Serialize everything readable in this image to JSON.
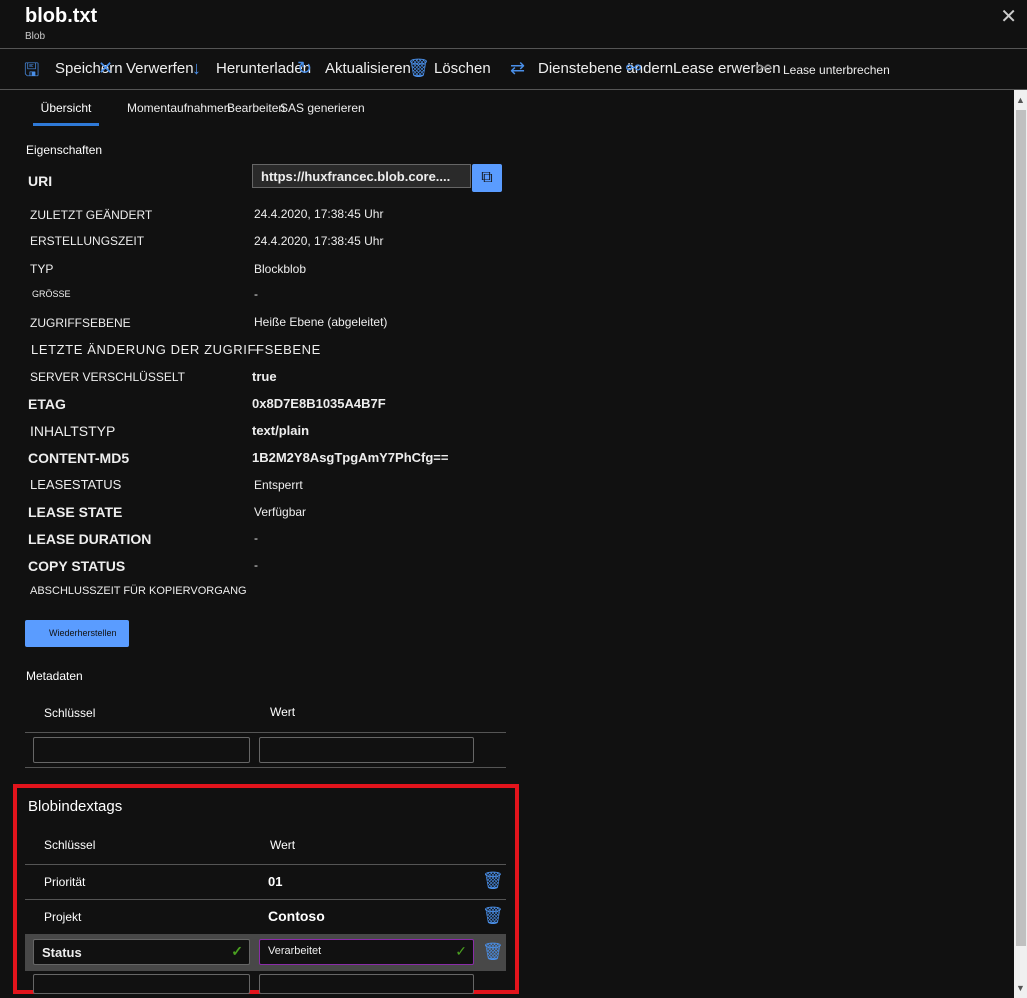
{
  "header": {
    "title": "blob.txt",
    "subtitle": "Blob",
    "close_icon": "close-icon"
  },
  "toolbar": [
    {
      "label": "Speichern",
      "icon": "save-icon"
    },
    {
      "label": "Verwerfen",
      "icon": "discard-icon"
    },
    {
      "label": "Herunterladen",
      "icon": "download-icon"
    },
    {
      "label": "Aktualisieren",
      "icon": "refresh-icon"
    },
    {
      "label": "Löschen",
      "icon": "trash-icon"
    },
    {
      "label": "Dienstebene ändern",
      "icon": "swap-icon"
    },
    {
      "label": "Lease erwerben",
      "icon": "link-icon"
    },
    {
      "label": "Lease unterbrechen",
      "icon": "broken-link-icon"
    }
  ],
  "tabs": [
    "Übersicht",
    "Momentaufnahmen",
    "Bearbeiten",
    "SAS generieren"
  ],
  "properties": {
    "section_title": "Eigenschaften",
    "uri_label": "URI",
    "uri_value": "https://huxfrancec.blob.core....",
    "rows": [
      {
        "label": "ZULETZT GEÄNDERT",
        "value": "24.4.2020, 17:38:45 Uhr"
      },
      {
        "label": "ERSTELLUNGSZEIT",
        "value": "24.4.2020, 17:38:45 Uhr"
      },
      {
        "label": "TYP",
        "value": "Blockblob"
      },
      {
        "label": "GRÖSSE",
        "value": "-"
      },
      {
        "label": "ZUGRIFFSEBENE",
        "value": "Heiße Ebene (abgeleitet)"
      },
      {
        "label": "LETZTE ÄNDERUNG DER ZUGRIFFSEBENE",
        "value": "-"
      },
      {
        "label": "SERVER VERSCHLÜSSELT",
        "value": "true"
      },
      {
        "label": "ETAG",
        "value": "0x8D7E8B1035A4B7F"
      },
      {
        "label": "INHALTSTYP",
        "value": "text/plain"
      },
      {
        "label": "CONTENT-MD5",
        "value": "1B2M2Y8AsgTpgAmY7PhCfg=="
      },
      {
        "label": "LEASESTATUS",
        "value": "Entsperrt"
      },
      {
        "label": "LEASE STATE",
        "value": "Verfügbar"
      },
      {
        "label": "LEASE DURATION",
        "value": "-"
      },
      {
        "label": "COPY STATUS",
        "value": "-"
      },
      {
        "label": "ABSCHLUSSZEIT FÜR KOPIERVORGANG",
        "value": ""
      }
    ],
    "restore_button": "Wiederherstellen"
  },
  "metadata": {
    "title": "Metadaten",
    "key_header": "Schlüssel",
    "value_header": "Wert",
    "key_input": "",
    "value_input": ""
  },
  "tags": {
    "title": "Blobindextags",
    "key_header": "Schlüssel",
    "value_header": "Wert",
    "rows": [
      {
        "key": "Priorität",
        "value": "01"
      },
      {
        "key": "Projekt",
        "value": "Contoso"
      }
    ],
    "edit_row": {
      "key": "Status",
      "value": "Verarbeitet"
    },
    "new_key": "",
    "new_value": ""
  }
}
